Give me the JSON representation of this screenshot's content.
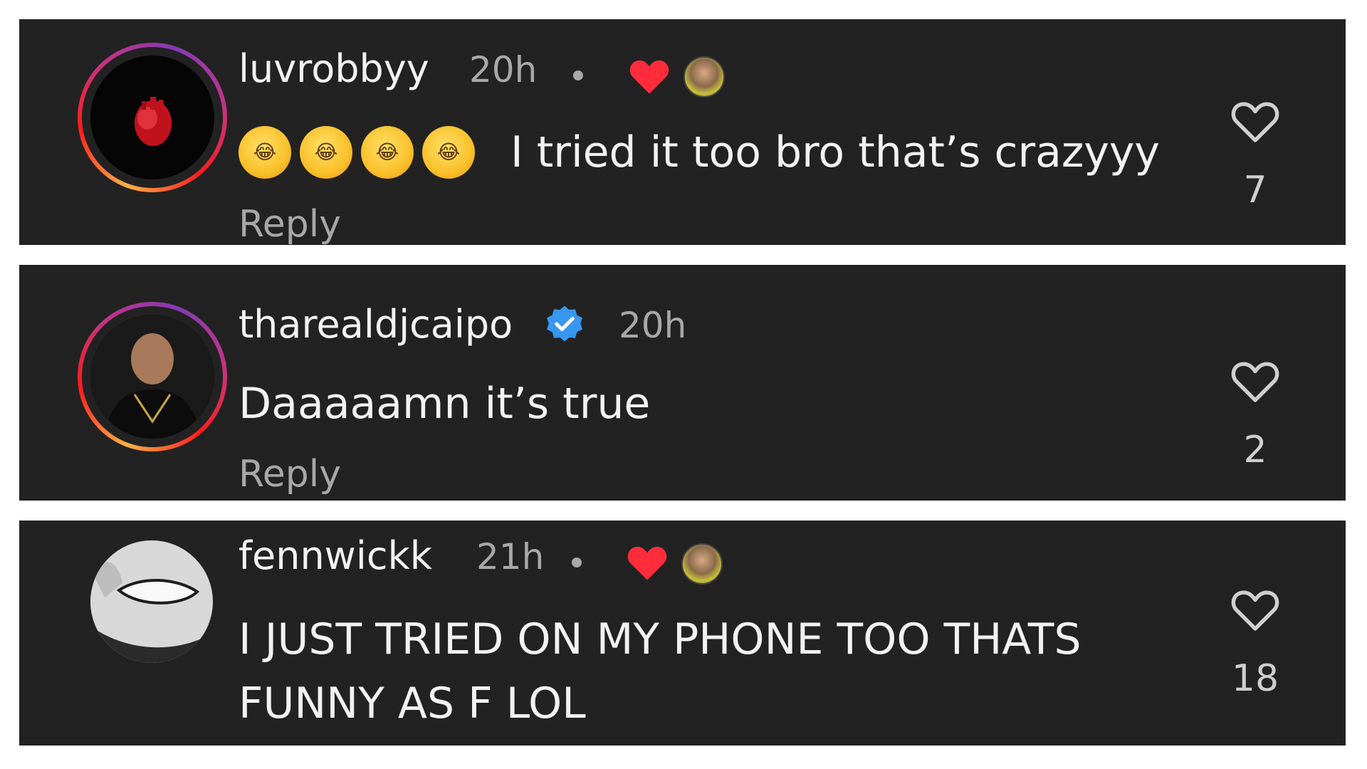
{
  "comments": [
    {
      "username": "luvrobbyy",
      "time": "20h",
      "emojis": [
        "rofl-emoji",
        "rofl-emoji",
        "rofl-emoji",
        "rofl-emoji"
      ],
      "text": "I tried it too bro that’s crazyyy",
      "reply_label": "Reply",
      "likes": "7",
      "liked_by_creator": true,
      "verified": false
    },
    {
      "username": "tharealdjcaipo",
      "time": "20h",
      "text": "Daaaaamn it’s true",
      "reply_label": "Reply",
      "likes": "2",
      "liked_by_creator": false,
      "verified": true
    },
    {
      "username": "fennwickk",
      "time": "21h",
      "text_line1": "I JUST TRIED ON MY PHONE TOO THATS",
      "text_line2": "FUNNY AS F LOL",
      "likes": "18",
      "liked_by_creator": true,
      "verified": false
    }
  ],
  "colors": {
    "panel_bg": "#222222",
    "text_primary": "#f2f2f2",
    "text_secondary": "#a8a8a8",
    "creator_heart": "#ff2d3c",
    "verified_badge": "#3897f0"
  },
  "icons": {
    "like": "heart-outline-icon",
    "creator_like": "heart-filled-icon",
    "verified": "verified-badge-icon"
  }
}
